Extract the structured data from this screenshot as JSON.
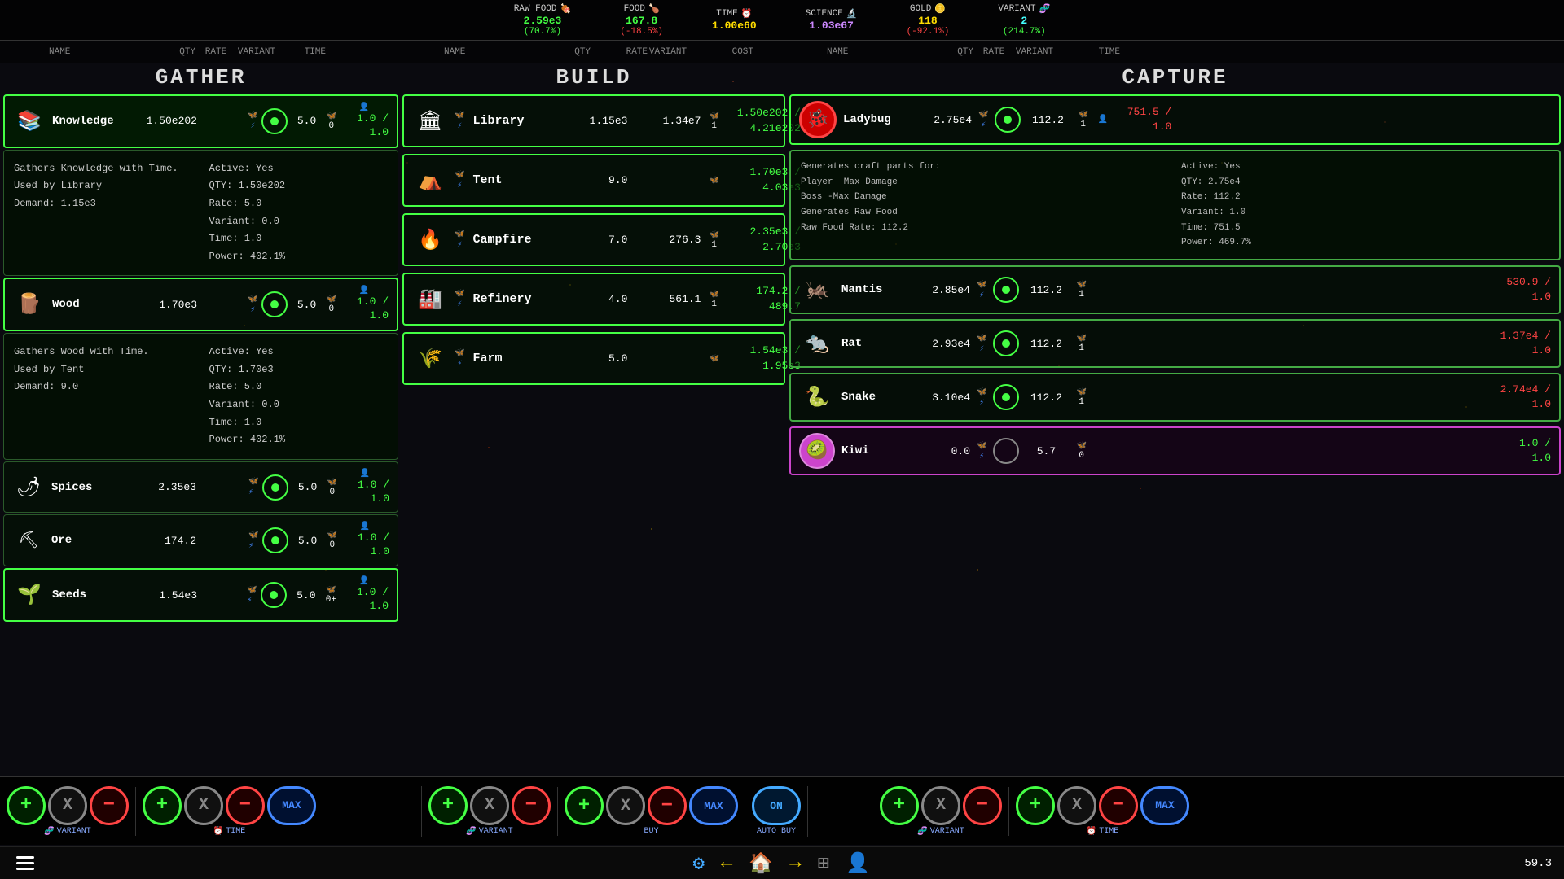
{
  "topBar": {
    "resources": [
      {
        "label": "RAW FOOD",
        "icon": "🍖",
        "value": "2.59e3",
        "rate": "(70.7%)",
        "valueColor": "positive",
        "rateColor": "positive"
      },
      {
        "label": "FOOD",
        "icon": "🍗",
        "value": "167.8",
        "rate": "(-18.5%)",
        "valueColor": "positive",
        "rateColor": "negative"
      },
      {
        "label": "TIME",
        "icon": "⏰",
        "value": "1.00e60",
        "rate": "",
        "valueColor": "yellow",
        "rateColor": "yellow"
      },
      {
        "label": "SCIENCE",
        "icon": "🔬",
        "value": "1.03e67",
        "rate": "",
        "valueColor": "purple",
        "rateColor": "purple"
      },
      {
        "label": "GOLD",
        "icon": "🪙",
        "value": "118",
        "rate": "(-92.1%)",
        "valueColor": "yellow",
        "rateColor": "negative"
      },
      {
        "label": "VARIANT",
        "icon": "🧬",
        "value": "2",
        "rate": "(214.7%)",
        "valueColor": "cyan",
        "rateColor": "positive"
      }
    ]
  },
  "sections": {
    "gather": {
      "title": "GATHER",
      "items": [
        {
          "name": "Knowledge",
          "icon": "📚",
          "qty": "1.50e202",
          "rate": "5.0",
          "variant": "0",
          "time": "1.0 /\n1.0",
          "timeColor": "positive",
          "active": true
        },
        {
          "name": "Wood",
          "icon": "🪵",
          "qty": "1.70e3",
          "rate": "5.0",
          "variant": "0",
          "time": "1.0 /\n1.0",
          "timeColor": "positive",
          "active": false
        },
        {
          "name": "Spices",
          "icon": "🌶",
          "qty": "2.35e3",
          "rate": "5.0",
          "variant": "0",
          "time": "1.0 /\n1.0",
          "timeColor": "positive",
          "active": false
        },
        {
          "name": "Ore",
          "icon": "⛏",
          "qty": "174.2",
          "rate": "5.0",
          "variant": "0",
          "time": "1.0 /\n1.0",
          "timeColor": "positive",
          "active": false
        },
        {
          "name": "Seeds",
          "icon": "🌱",
          "qty": "1.54e3",
          "rate": "5.0",
          "variant": "0+",
          "time": "1.0 /\n1.0",
          "timeColor": "positive",
          "active": false
        }
      ],
      "knowledgeDetail": {
        "left": {
          "line1": "Gathers Knowledge with Time.",
          "line2": "Used by Library",
          "line3": "Demand: 1.15e3"
        },
        "right": {
          "active": "Active: Yes",
          "qty": "QTY: 1.50e202",
          "rate": "Rate: 5.0",
          "variant": "Variant: 0.0",
          "time": "Time: 1.0",
          "power": "Power: 402.1%"
        }
      },
      "woodDetail": {
        "left": {
          "line1": "Gathers Wood with Time.",
          "line2": "Used by Tent",
          "line3": "Demand: 9.0"
        },
        "right": {
          "active": "Active: Yes",
          "qty": "QTY: 1.70e3",
          "rate": "Rate: 5.0",
          "variant": "Variant: 0.0",
          "time": "Time: 1.0",
          "power": "Power: 402.1%"
        }
      }
    },
    "build": {
      "title": "BUILD",
      "items": [
        {
          "name": "Library",
          "icon": "🏛",
          "qty": "1.15e3",
          "rate": "1.34e7",
          "variant": "1",
          "cost": "1.50e202 /\n4.21e202",
          "costColor": "positive"
        },
        {
          "name": "Tent",
          "icon": "⛺",
          "qty": "9.0",
          "rate": "",
          "variant": "",
          "cost": "1.70e3 /\n4.03e3",
          "costColor": "positive"
        },
        {
          "name": "Campfire",
          "icon": "🔥",
          "qty": "7.0",
          "rate": "276.3",
          "variant": "1",
          "cost": "2.35e3 /\n2.70e3",
          "costColor": "positive"
        },
        {
          "name": "Refinery",
          "icon": "🏭",
          "qty": "4.0",
          "rate": "561.1",
          "variant": "1",
          "cost": "174.2 /\n489.7",
          "costColor": "positive"
        },
        {
          "name": "Farm",
          "icon": "🌾",
          "qty": "5.0",
          "rate": "",
          "variant": "",
          "cost": "1.54e3 /\n1.95e3",
          "costColor": "positive"
        }
      ]
    },
    "capture": {
      "title": "CAPTURE",
      "items": [
        {
          "name": "Ladybug",
          "icon": "🐞",
          "qty": "2.75e4",
          "rate": "112.2",
          "variant": "1",
          "time": "751.5 /\n1.0",
          "timeColor": "red",
          "active": true,
          "showDetail": true
        },
        {
          "name": "Mantis",
          "icon": "🦗",
          "qty": "2.85e4",
          "rate": "112.2",
          "variant": "1",
          "time": "530.9 /\n1.0",
          "timeColor": "red",
          "active": false
        },
        {
          "name": "Rat",
          "icon": "🐀",
          "qty": "2.93e4",
          "rate": "112.2",
          "variant": "1",
          "time": "1.37e4 /\n1.0",
          "timeColor": "red",
          "active": false
        },
        {
          "name": "Snake",
          "icon": "🐍",
          "qty": "3.10e4",
          "rate": "112.2",
          "variant": "1",
          "time": "2.74e4 /\n1.0",
          "timeColor": "red",
          "active": false
        },
        {
          "name": "Kiwi",
          "icon": "🥝",
          "qty": "0.0",
          "rate": "5.7",
          "variant": "0",
          "time": "1.0 /\n1.0",
          "timeColor": "positive",
          "active": false,
          "isKiwi": true
        }
      ],
      "ladybugDetail": {
        "left": {
          "line1": "Generates craft parts for:",
          "line2": "Player +Max Damage",
          "line3": "Boss -Max Damage",
          "line4": "Generates Raw Food",
          "line5": "Raw Food Rate: 112.2"
        },
        "right": {
          "active": "Active: Yes",
          "qty": "QTY: 2.75e4",
          "rate": "Rate: 112.2",
          "variant": "Variant: 1.0",
          "time": "Time: 751.5",
          "power": "Power: 469.7%"
        }
      }
    }
  },
  "bottomControls": {
    "gatherVariant": {
      "label": "VARIANT",
      "icon": "🧬"
    },
    "gatherTime": {
      "label": "TIME",
      "icon": "⏰"
    },
    "buildVariant": {
      "label": "VARIANT",
      "icon": "🧬"
    },
    "buildBuy": {
      "label": "BUY"
    },
    "buildAutoBuy": {
      "label": "AUTO BUY"
    },
    "captureVariant": {
      "label": "VARIANT",
      "icon": "🧬"
    },
    "captureTime": {
      "label": "TIME",
      "icon": "⏰"
    },
    "buttons": {
      "plus": "+",
      "x": "X",
      "minus": "−",
      "max": "MAX",
      "on": "ON"
    }
  },
  "nav": {
    "scoreValue": "59.3",
    "icons": {
      "menu": "≡",
      "gear": "⚙",
      "back": "←",
      "home": "🏠",
      "forward": "→",
      "grid": "⊞",
      "person": "👤"
    }
  }
}
